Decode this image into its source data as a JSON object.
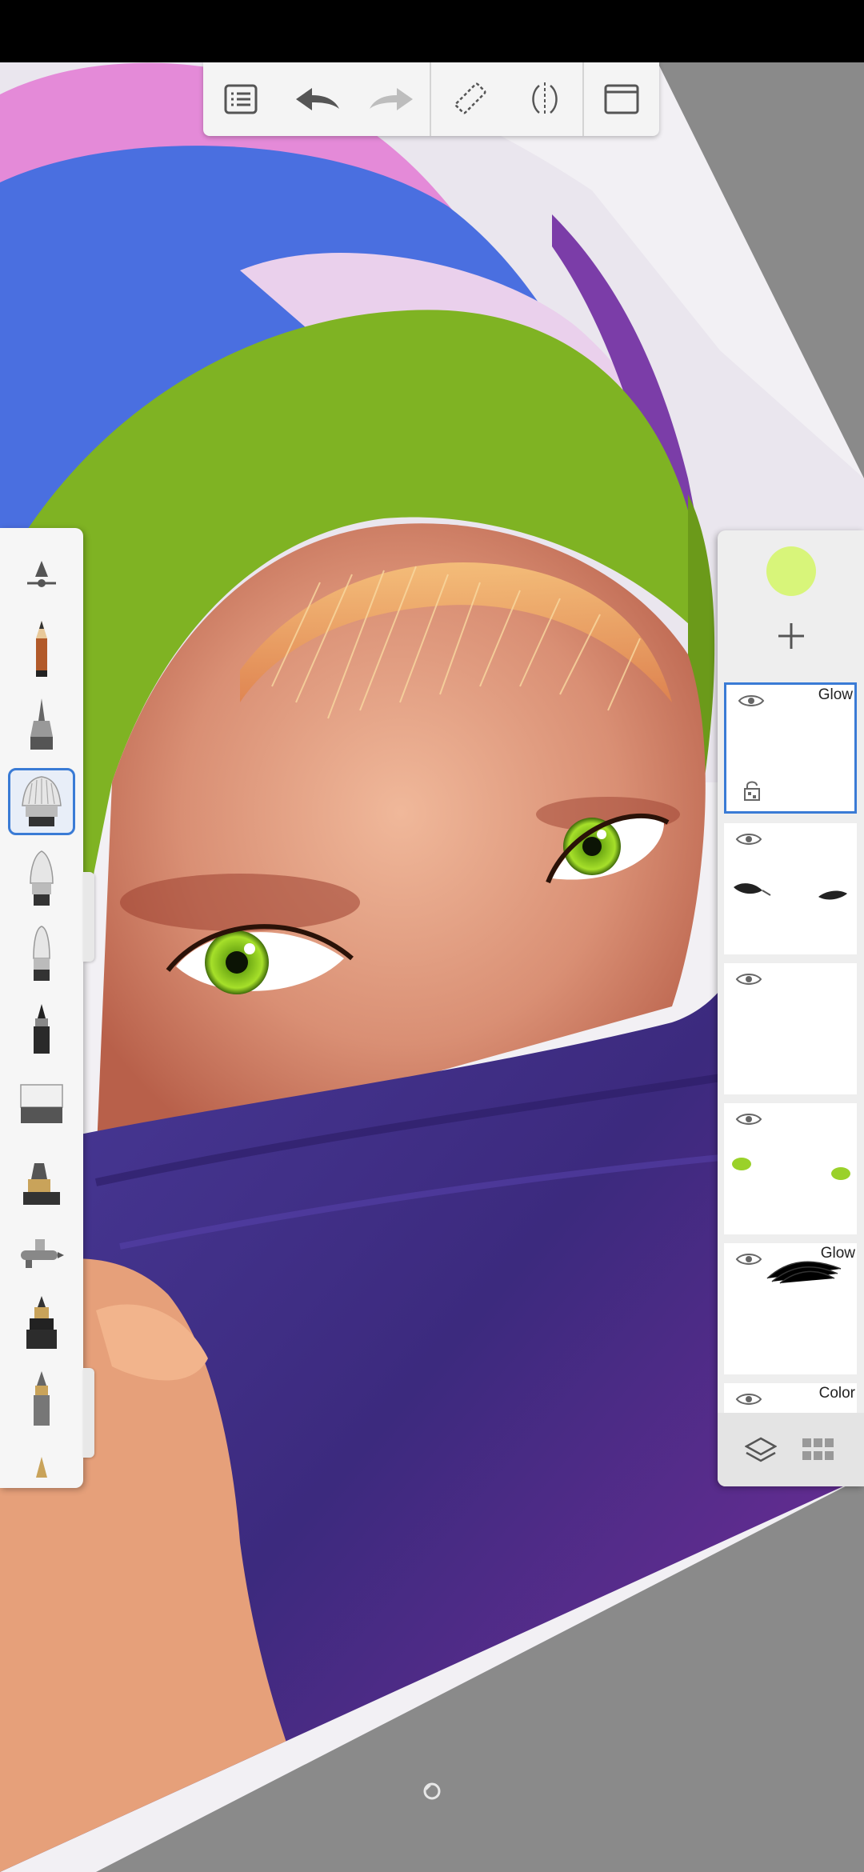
{
  "toolbar": {
    "items": [
      "menu-icon",
      "undo-icon",
      "redo-icon",
      "ruler-icon",
      "symmetry-icon",
      "fullscreen-icon"
    ]
  },
  "brushes": {
    "items": [
      "brush-properties",
      "pencil",
      "ballpoint-pen",
      "paint-brush",
      "hard-brush",
      "soft-brush",
      "marker",
      "eraser",
      "chisel-brush",
      "airbrush",
      "ink-pen",
      "felt-tip",
      "smudge"
    ],
    "selected": "paint-brush"
  },
  "layers": {
    "current_color": "#d8f57a",
    "items": [
      {
        "blend": "Glow",
        "selected": true,
        "locked": false
      },
      {
        "blend": "",
        "selected": false
      },
      {
        "blend": "",
        "selected": false
      },
      {
        "blend": "",
        "selected": false
      },
      {
        "blend": "Glow",
        "selected": false
      },
      {
        "blend": "Color",
        "selected": false
      }
    ]
  },
  "colors": {
    "accent": "#3a7bd5",
    "hijab_green": "#7fb323",
    "hijab_blue": "#4a6fe0",
    "hijab_pink": "#e8b8e6",
    "scarf_purple": "#4a2f8a",
    "eye_green": "#8fd12a"
  }
}
